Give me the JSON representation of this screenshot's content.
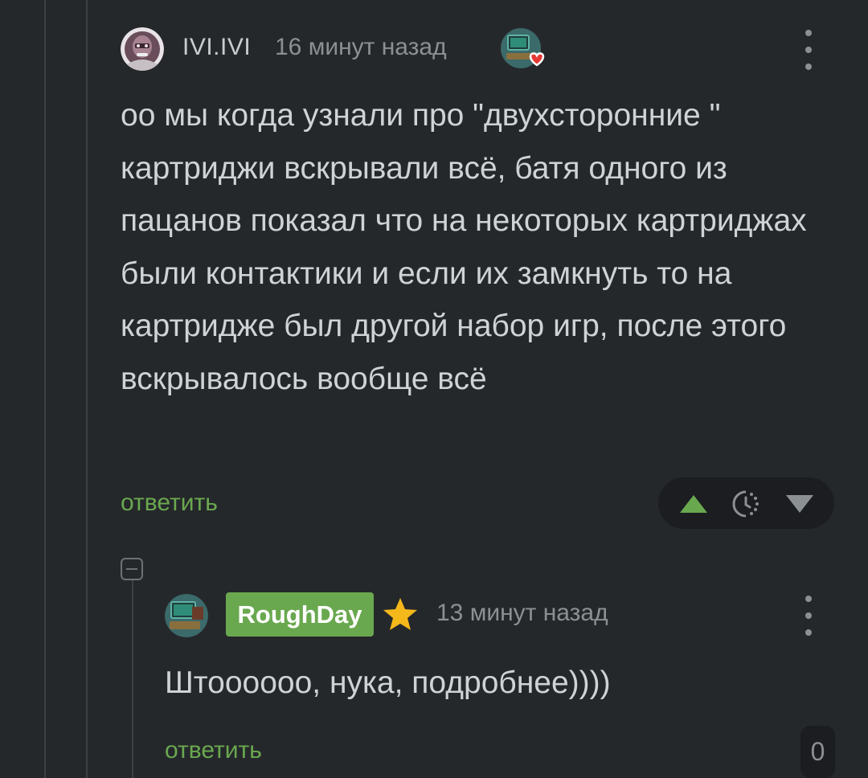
{
  "comment1": {
    "username": "IVI.IVI",
    "time": "16 минут назад",
    "author_icon": "heart-badge-icon",
    "text": "оо мы когда узнали про \"двухсторонние \" картриджи вскрывали всё, батя одного из пацанов показал что на некоторых картриджах были контактики и если их замкнуть то на картридже был другой набор игр, после этого вскрывалось вообще всё",
    "reply_label": "ответить"
  },
  "comment2": {
    "username": "RoughDay",
    "user_badge_icon": "star-icon",
    "time": "13 минут назад",
    "text": "Штоооооо, нука, подробнее))))",
    "reply_label": "ответить",
    "rating": "0"
  },
  "colors": {
    "background": "#25282b",
    "accent_green": "#6aa84f",
    "star": "#f5b81a",
    "heart": "#e53935"
  }
}
